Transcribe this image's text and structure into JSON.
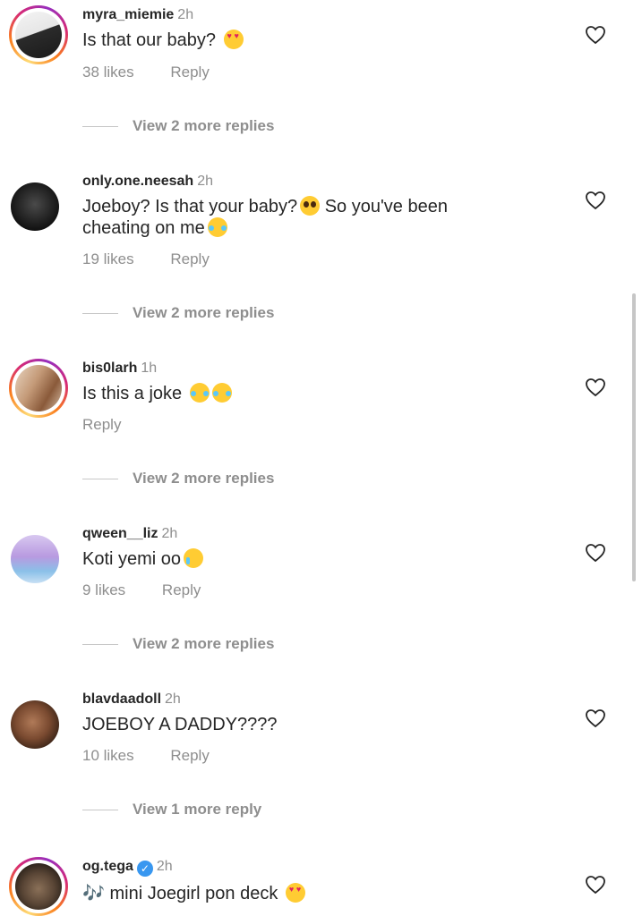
{
  "comments": [
    {
      "username": "myra_miemie",
      "time": "2h",
      "text": "Is that our baby?",
      "emoji": "heart-eyes-emoji",
      "likes": "38 likes",
      "reply": "Reply",
      "view_more": "View 2 more replies",
      "has_ring": true,
      "avatar_colors": [
        "#f2f2f2",
        "#2b2b2b"
      ]
    },
    {
      "username": "only.one.neesah",
      "time": "2h",
      "text_line1": "Joeboy? Is that your baby?",
      "text_line1b": "So you've been",
      "text_line2": "cheating on me",
      "likes": "19 likes",
      "reply": "Reply",
      "view_more": "View 2 more replies",
      "has_ring": false,
      "avatar_colors": [
        "#3a3a3a",
        "#111111"
      ]
    },
    {
      "username": "bis0larh",
      "time": "1h",
      "text": "Is this a joke",
      "reply": "Reply",
      "view_more": "View 2 more replies",
      "has_ring": true,
      "avatar_colors": [
        "#c9a98a",
        "#8a5a3a"
      ]
    },
    {
      "username": "qween__liz",
      "time": "2h",
      "text": "Koti yemi oo",
      "likes": "9 likes",
      "reply": "Reply",
      "view_more": "View 2 more replies",
      "has_ring": false,
      "avatar_colors": [
        "#c9a8e8",
        "#8ab8e0"
      ]
    },
    {
      "username": "blavdaadoll",
      "time": "2h",
      "text": "JOEBOY A DADDY????",
      "likes": "10 likes",
      "reply": "Reply",
      "view_more": "View 1 more reply",
      "has_ring": false,
      "avatar_colors": [
        "#8a5a40",
        "#3a2418"
      ]
    },
    {
      "username": "og.tega",
      "time": "2h",
      "verified": true,
      "music_prefix": "🎶",
      "text": "mini Joegirl pon deck",
      "has_ring": true,
      "avatar_colors": [
        "#7a6a5a",
        "#2a2018"
      ]
    }
  ],
  "colors": {
    "text": "#262626",
    "secondary": "#8e8e8e",
    "verified": "#3897f0"
  }
}
